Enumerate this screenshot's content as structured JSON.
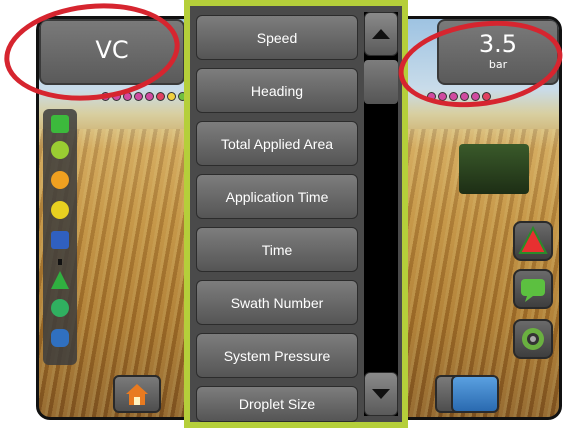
{
  "left_tile": {
    "value": "VC"
  },
  "right_tile": {
    "value": "3.5",
    "unit": "bar"
  },
  "menu": {
    "items": [
      "Speed",
      "Heading",
      "Total Applied Area",
      "Application Time",
      "Time",
      "Swath Number",
      "System Pressure",
      "Droplet Size"
    ],
    "scroll_up_icon": "triangle-up-icon",
    "scroll_down_icon": "triangle-down-icon"
  },
  "colors": {
    "menu_border": "#b5cf3a",
    "highlight_circle": "#d6252f"
  },
  "dots_left": [
    "#d04aa0",
    "#d04aa0",
    "#d04aa0",
    "#d04aa0",
    "#d04aa0",
    "#e04060",
    "#f0d040",
    "#70c040"
  ],
  "dots_right": [
    "#d04aa0",
    "#d04aa0",
    "#d04aa0",
    "#d04aa0",
    "#d04aa0",
    "#e04060"
  ]
}
